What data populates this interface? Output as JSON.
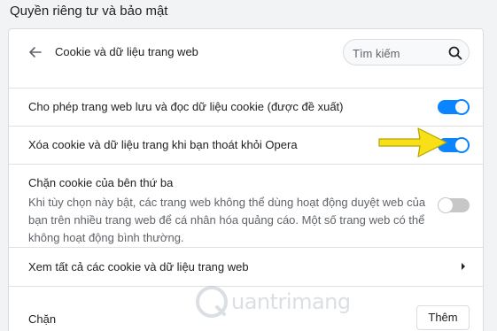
{
  "section": {
    "title": "Quyền riêng tư và bảo mật"
  },
  "header": {
    "title": "Cookie và dữ liệu trang web",
    "search_placeholder": "Tìm kiếm"
  },
  "settings": [
    {
      "label": "Cho phép trang web lưu và đọc dữ liệu cookie (được đề xuất)",
      "enabled": true
    },
    {
      "label": "Xóa cookie và dữ liệu trang khi bạn thoát khỏi Opera",
      "enabled": true
    },
    {
      "label": "Chặn cookie của bên thứ ba",
      "description": "Khi tùy chọn này bật, các trang web không thể dùng hoạt động duyệt web của bạn trên nhiều trang web để cá nhân hóa quảng cáo. Một số trang web có thể không hoạt động bình thường.",
      "enabled": false
    }
  ],
  "see_all": {
    "label": "Xem tất cả các cookie và dữ liệu trang web"
  },
  "block": {
    "label": "Chặn",
    "add_label": "Thêm"
  },
  "watermark": {
    "text": "uantrimang"
  },
  "colors": {
    "accent": "#0a84ff",
    "arrow": "#f7e017"
  }
}
